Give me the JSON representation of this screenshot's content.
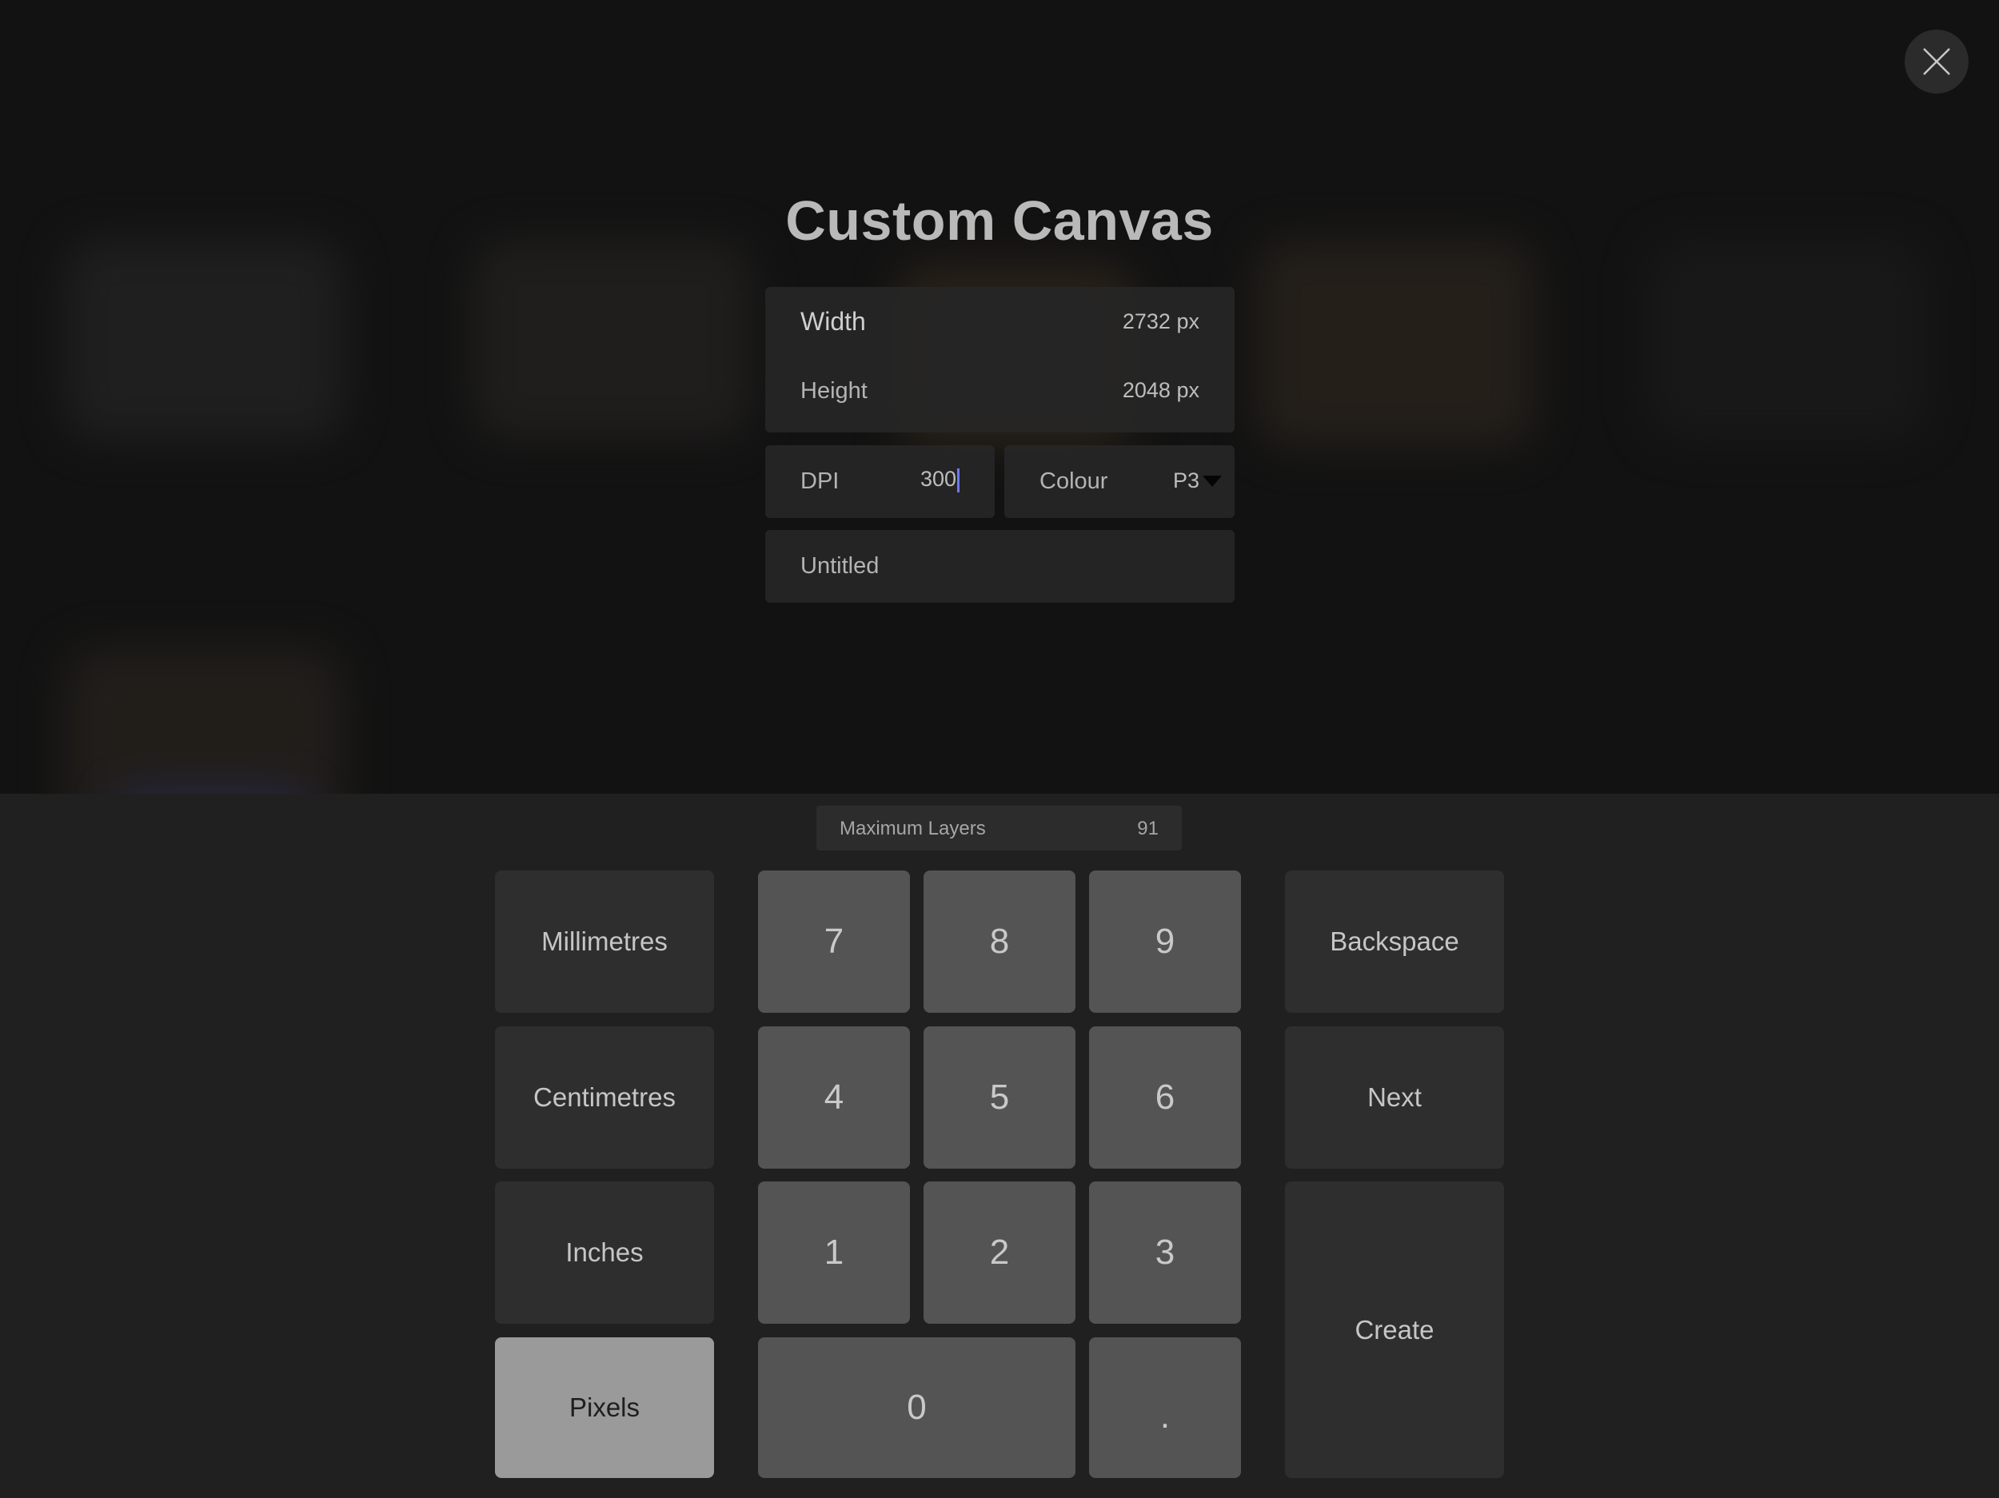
{
  "dialog": {
    "title": "Custom Canvas",
    "close_icon": "close-icon"
  },
  "dimensions": {
    "width_label": "Width",
    "width_value": "2732",
    "width_unit": "px",
    "height_label": "Height",
    "height_value": "2048",
    "height_unit": "px"
  },
  "dpi": {
    "label": "DPI",
    "value": "300"
  },
  "colour": {
    "label": "Colour",
    "value": "P3",
    "dropdown_icon": "triangle-down-icon"
  },
  "name_field": {
    "value": "Untitled"
  },
  "max_layers": {
    "label": "Maximum Layers",
    "value": "91"
  },
  "units": {
    "millimetres": "Millimetres",
    "centimetres": "Centimetres",
    "inches": "Inches",
    "pixels": "Pixels",
    "selected": "Pixels"
  },
  "numpad": {
    "k7": "7",
    "k8": "8",
    "k9": "9",
    "k4": "4",
    "k5": "5",
    "k6": "6",
    "k1": "1",
    "k2": "2",
    "k3": "3",
    "k0": "0",
    "dot": "."
  },
  "actions": {
    "backspace": "Backspace",
    "next": "Next",
    "create": "Create"
  },
  "colors": {
    "caret": "#6f78ff",
    "selected_unit_bg": "#9a9a9a",
    "number_key_bg": "#545454"
  }
}
